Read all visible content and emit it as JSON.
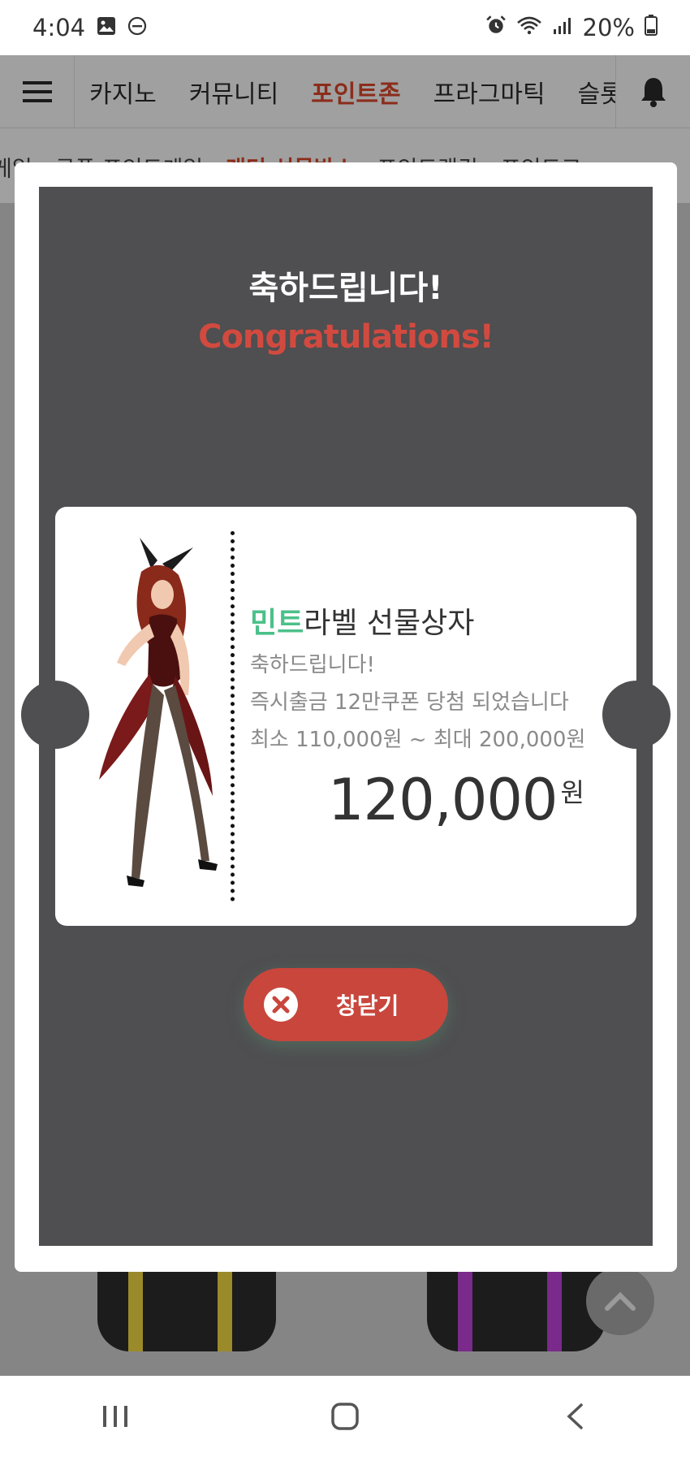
{
  "status_bar": {
    "time": "4:04",
    "battery": "20%",
    "icons": [
      "image-icon",
      "do-not-disturb-icon",
      "alarm-icon",
      "wifi-icon",
      "signal-icon",
      "battery-icon"
    ]
  },
  "top_nav": {
    "tabs": [
      {
        "label": "카지노",
        "active": false
      },
      {
        "label": "커뮤니티",
        "active": false
      },
      {
        "label": "포인트존",
        "active": true
      },
      {
        "label": "프라그마틱",
        "active": false
      },
      {
        "label": "슬롯",
        "active": false
      }
    ],
    "active_color": "#8b2d1a"
  },
  "sub_nav": {
    "tabs": [
      {
        "label": "게임",
        "active": false
      },
      {
        "label": "쿠폰 포인트게임",
        "active": false
      },
      {
        "label": "래더 선물박스",
        "active": true
      },
      {
        "label": "포인트랭킹",
        "active": false
      },
      {
        "label": "포인트교",
        "active": false
      }
    ]
  },
  "modal": {
    "title": "축하드립니다!",
    "subtitle": "Congratulations!",
    "subtitle_color": "#d24a3f",
    "ticket": {
      "title_highlight": "민트",
      "title_rest": "라벨 선물상자",
      "highlight_color": "#4cc08a",
      "line1": "축하드립니다!",
      "line2": "즉시출금 12만쿠폰 당첨 되었습니다",
      "line3": "최소 110,000원 ~ 최대 200,000원",
      "amount": "120,000",
      "unit": "원"
    },
    "close_button": {
      "label": "창닫기",
      "color": "#c9463c"
    }
  }
}
